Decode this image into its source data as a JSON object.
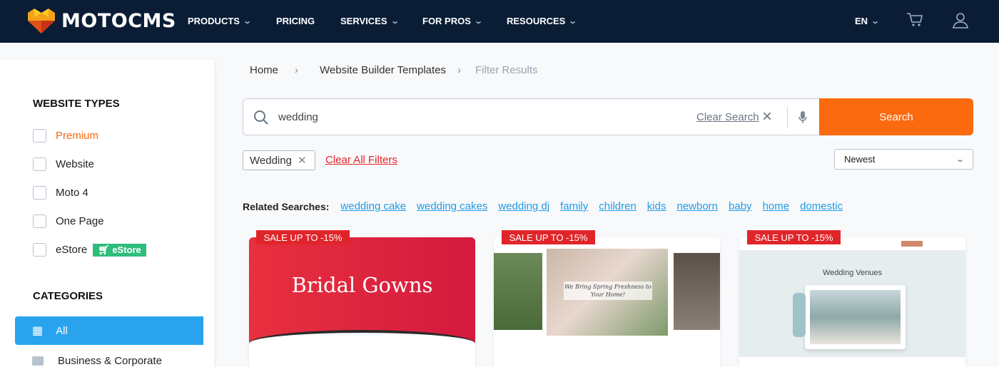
{
  "header": {
    "brand": "MOTOCMS",
    "nav": [
      {
        "label": "PRODUCTS",
        "dropdown": true
      },
      {
        "label": "PRICING",
        "dropdown": false
      },
      {
        "label": "SERVICES",
        "dropdown": true
      },
      {
        "label": "FOR PROS",
        "dropdown": true
      },
      {
        "label": "RESOURCES",
        "dropdown": true
      }
    ],
    "language": "EN",
    "icons": [
      "cart-icon",
      "user-icon"
    ]
  },
  "sidebar": {
    "website_types_title": "WEBSITE TYPES",
    "types": [
      {
        "label": "Premium",
        "checked": false,
        "color": "#f26a10"
      },
      {
        "label": "Website",
        "checked": false
      },
      {
        "label": "Moto 4",
        "checked": false
      },
      {
        "label": "One Page",
        "checked": false
      },
      {
        "label": "eStore",
        "checked": false,
        "badge": "eStore"
      }
    ],
    "categories_title": "CATEGORIES",
    "categories": [
      {
        "label": "All",
        "active": true
      },
      {
        "label": "Business & Corporate",
        "active": false
      }
    ]
  },
  "breadcrumb": [
    "Home",
    "Website Builder Templates",
    "Filter Results"
  ],
  "search": {
    "value": "wedding",
    "clear_label": "Clear Search",
    "button": "Search"
  },
  "filters": {
    "chip": "Wedding",
    "clear_all": "Clear All Filters",
    "sort": "Newest"
  },
  "related": {
    "label": "Related Searches:",
    "items": [
      "wedding cake",
      "wedding cakes",
      "wedding dj",
      "family",
      "children",
      "kids",
      "newborn",
      "baby",
      "home",
      "domestic"
    ]
  },
  "cards": [
    {
      "sale": "SALE UP TO -15%",
      "thumb_title": "Bridal Gowns"
    },
    {
      "sale": "SALE UP TO -15%",
      "thumb_title": "We Bring Spring Freshness to Your Home!"
    },
    {
      "sale": "SALE UP TO -15%",
      "thumb_title": "Wedding Venues"
    }
  ],
  "colors": {
    "header": "#0a1d35",
    "accent": "#fb6a0f",
    "link": "#1f9be6",
    "active": "#2aa3ef",
    "sale": "#e0252a"
  }
}
